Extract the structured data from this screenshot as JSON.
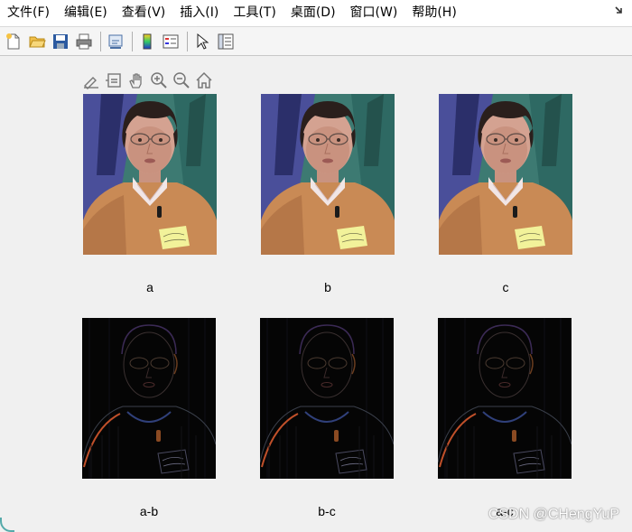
{
  "menu": [
    {
      "label": "文件(F)"
    },
    {
      "label": "编辑(E)"
    },
    {
      "label": "查看(V)"
    },
    {
      "label": "插入(I)"
    },
    {
      "label": "工具(T)"
    },
    {
      "label": "桌面(D)"
    },
    {
      "label": "窗口(W)"
    },
    {
      "label": "帮助(H)"
    }
  ],
  "toolbar": {
    "icons": [
      "new-file-icon",
      "open-folder-icon",
      "save-icon",
      "print-icon",
      "link-figure-icon",
      "colorbar-icon",
      "legend-icon",
      "pointer-icon",
      "property-inspector-icon"
    ]
  },
  "axes_toolbar": {
    "icons": [
      "brush-icon",
      "data-tips-icon",
      "pan-hand-icon",
      "zoom-in-icon",
      "zoom-out-icon",
      "home-icon"
    ]
  },
  "panels": [
    {
      "caption": "a",
      "kind": "color"
    },
    {
      "caption": "b",
      "kind": "color"
    },
    {
      "caption": "c",
      "kind": "color"
    },
    {
      "caption": "a-b",
      "kind": "diff"
    },
    {
      "caption": "b-c",
      "kind": "diff"
    },
    {
      "caption": "a-c",
      "kind": "diff"
    }
  ],
  "watermark": "CSDN @CHengYuP",
  "colors": {
    "background": "#f0f0f0",
    "sweater": "#c98a55",
    "backdrop_blue": "#4a4f9a",
    "backdrop_teal": "#3d7a72",
    "diff_black": "#050505"
  }
}
